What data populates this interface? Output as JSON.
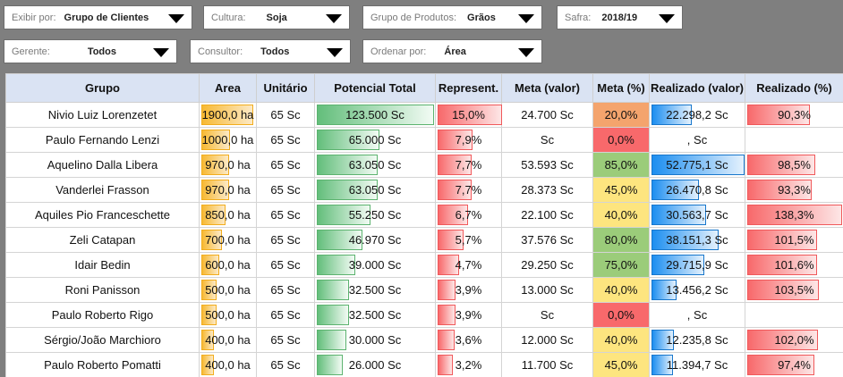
{
  "filters": {
    "exibir": {
      "label": "Exibir por:",
      "value": "Grupo de Clientes"
    },
    "cultura": {
      "label": "Cultura:",
      "value": "Soja"
    },
    "grupo_produtos": {
      "label": "Grupo de Produtos:",
      "value": "Grãos"
    },
    "safra": {
      "label": "Safra:",
      "value": "2018/19"
    },
    "gerente": {
      "label": "Gerente:",
      "value": "Todos"
    },
    "consultor": {
      "label": "Consultor:",
      "value": "Todos"
    },
    "ordenar": {
      "label": "Ordenar por:",
      "value": "Área"
    }
  },
  "table": {
    "headers": [
      "Grupo",
      "Area",
      "Unitário",
      "Potencial Total",
      "Represent.",
      "Meta (valor)",
      "Meta (%)",
      "Realizado (valor)",
      "Realizado (%)"
    ],
    "rows": [
      {
        "grupo": "Nivio Luiz Lorenzetet",
        "area": "1900,0 ha",
        "area_frac": 1.0,
        "unit": "65 Sc",
        "pot": "123.500 Sc",
        "pot_frac": 1.0,
        "rep": "15,0%",
        "rep_frac": 1.0,
        "meta": "24.700 Sc",
        "meta_pct": "20,0%",
        "meta_color": "#f4a46d",
        "real": "22.298,2 Sc",
        "real_frac": 0.42,
        "rp": "90,3%",
        "rp_frac": 0.65
      },
      {
        "grupo": "Paulo Fernando Lenzi",
        "area": "1000,0 ha",
        "area_frac": 0.53,
        "unit": "65 Sc",
        "pot": "65.000 Sc",
        "pot_frac": 0.53,
        "rep": "7,9%",
        "rep_frac": 0.53,
        "meta": "Sc",
        "meta_pct": "0,0%",
        "meta_color": "#f8696b",
        "real": ", Sc",
        "real_frac": 0,
        "rp": "",
        "rp_frac": 0
      },
      {
        "grupo": "Aquelino Dalla Libera",
        "area": "970,0 ha",
        "area_frac": 0.51,
        "unit": "65 Sc",
        "pot": "63.050 Sc",
        "pot_frac": 0.51,
        "rep": "7,7%",
        "rep_frac": 0.51,
        "meta": "53.593 Sc",
        "meta_pct": "85,0%",
        "meta_color": "#9bcc7a",
        "real": "52.775,1 Sc",
        "real_frac": 1.0,
        "rp": "98,5%",
        "rp_frac": 0.71
      },
      {
        "grupo": "Vanderlei Frasson",
        "area": "970,0 ha",
        "area_frac": 0.51,
        "unit": "65 Sc",
        "pot": "63.050 Sc",
        "pot_frac": 0.51,
        "rep": "7,7%",
        "rep_frac": 0.51,
        "meta": "28.373 Sc",
        "meta_pct": "45,0%",
        "meta_color": "#fde57f",
        "real": "26.470,8 Sc",
        "real_frac": 0.5,
        "rp": "93,3%",
        "rp_frac": 0.67
      },
      {
        "grupo": "Aquiles Pio Franceschette",
        "area": "850,0 ha",
        "area_frac": 0.45,
        "unit": "65 Sc",
        "pot": "55.250 Sc",
        "pot_frac": 0.45,
        "rep": "6,7%",
        "rep_frac": 0.45,
        "meta": "22.100 Sc",
        "meta_pct": "40,0%",
        "meta_color": "#fde57f",
        "real": "30.563,7 Sc",
        "real_frac": 0.58,
        "rp": "138,3%",
        "rp_frac": 1.0
      },
      {
        "grupo": "Zeli Catapan",
        "area": "700,0 ha",
        "area_frac": 0.37,
        "unit": "65 Sc",
        "pot": "46.970 Sc",
        "pot_frac": 0.38,
        "rep": "5,7%",
        "rep_frac": 0.38,
        "meta": "37.576 Sc",
        "meta_pct": "80,0%",
        "meta_color": "#9bcc7a",
        "real": "38.151,3 Sc",
        "real_frac": 0.72,
        "rp": "101,5%",
        "rp_frac": 0.73
      },
      {
        "grupo": "Idair Bedin",
        "area": "600,0 ha",
        "area_frac": 0.32,
        "unit": "65 Sc",
        "pot": "39.000 Sc",
        "pot_frac": 0.32,
        "rep": "4,7%",
        "rep_frac": 0.32,
        "meta": "29.250 Sc",
        "meta_pct": "75,0%",
        "meta_color": "#9bcc7a",
        "real": "29.715,9 Sc",
        "real_frac": 0.56,
        "rp": "101,6%",
        "rp_frac": 0.73
      },
      {
        "grupo": "Roni Panisson",
        "area": "500,0 ha",
        "area_frac": 0.26,
        "unit": "65 Sc",
        "pot": "32.500 Sc",
        "pot_frac": 0.26,
        "rep": "3,9%",
        "rep_frac": 0.26,
        "meta": "13.000 Sc",
        "meta_pct": "40,0%",
        "meta_color": "#fde57f",
        "real": "13.456,2 Sc",
        "real_frac": 0.25,
        "rp": "103,5%",
        "rp_frac": 0.75
      },
      {
        "grupo": "Paulo Roberto Rigo",
        "area": "500,0 ha",
        "area_frac": 0.26,
        "unit": "65 Sc",
        "pot": "32.500 Sc",
        "pot_frac": 0.26,
        "rep": "3,9%",
        "rep_frac": 0.26,
        "meta": "Sc",
        "meta_pct": "0,0%",
        "meta_color": "#f8696b",
        "real": ", Sc",
        "real_frac": 0,
        "rp": "",
        "rp_frac": 0
      },
      {
        "grupo": "Sérgio/João Marchioro",
        "area": "400,0 ha",
        "area_frac": 0.21,
        "unit": "65 Sc",
        "pot": "30.000 Sc",
        "pot_frac": 0.24,
        "rep": "3,6%",
        "rep_frac": 0.24,
        "meta": "12.000 Sc",
        "meta_pct": "40,0%",
        "meta_color": "#fde57f",
        "real": "12.235,8 Sc",
        "real_frac": 0.23,
        "rp": "102,0%",
        "rp_frac": 0.74
      },
      {
        "grupo": "Paulo Roberto Pomatti",
        "area": "400,0 ha",
        "area_frac": 0.21,
        "unit": "65 Sc",
        "pot": "26.000 Sc",
        "pot_frac": 0.21,
        "rep": "3,2%",
        "rep_frac": 0.21,
        "meta": "11.700 Sc",
        "meta_pct": "45,0%",
        "meta_color": "#fde57f",
        "real": "11.394,7 Sc",
        "real_frac": 0.22,
        "rp": "97,4%",
        "rp_frac": 0.7
      }
    ]
  }
}
